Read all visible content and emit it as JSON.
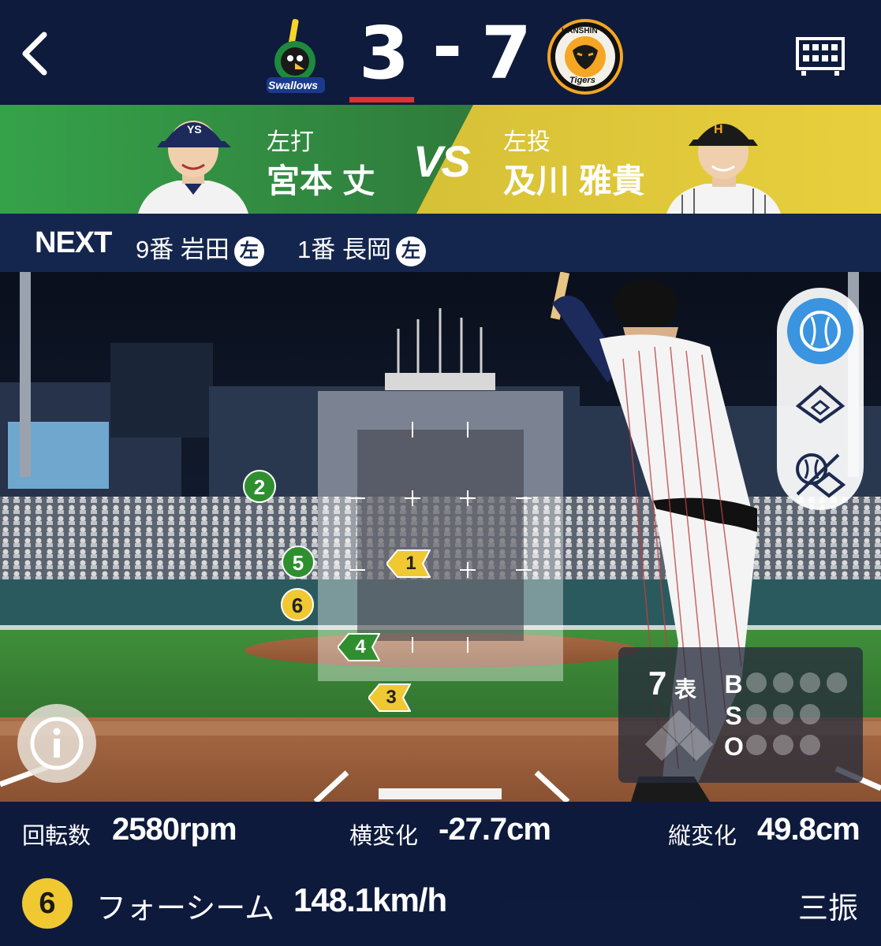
{
  "header": {
    "back_icon": "chevron-left-icon",
    "home_team_logo": "swallows-logo",
    "home_logo_text": "Swallows",
    "away_team_logo": "tigers-logo",
    "away_logo_top_text": "HANSHIN",
    "away_logo_bottom_text": "Tigers",
    "home_score": "3",
    "dash": "-",
    "away_score": "7",
    "scoreboard_icon": "scoreboard-icon"
  },
  "matchup": {
    "batter_hand_label": "左打",
    "batter_name": "宮本 丈",
    "vs_label": "VS",
    "pitcher_hand_label": "左投",
    "pitcher_name": "及川 雅貴",
    "batter_color": "#3aa84f",
    "pitcher_color": "#e3c93a"
  },
  "next": {
    "label": "NEXT",
    "items": [
      {
        "order": "9番 岩田",
        "hand": "左"
      },
      {
        "order": "1番 長岡",
        "hand": "左"
      }
    ]
  },
  "side_controls": [
    "pitch-icon",
    "field-diamond-icon",
    "pitch-field-icon"
  ],
  "pitches": [
    {
      "num": "1",
      "style": "yellow-arrow"
    },
    {
      "num": "2",
      "style": "green-circle"
    },
    {
      "num": "3",
      "style": "yellow-arrow"
    },
    {
      "num": "4",
      "style": "green-arrow"
    },
    {
      "num": "5",
      "style": "green-circle"
    },
    {
      "num": "6",
      "style": "yellow-circle"
    }
  ],
  "count": {
    "inning": "7",
    "half": "表",
    "b_label": "B",
    "s_label": "S",
    "o_label": "O"
  },
  "stats": {
    "spin_label": "回転数",
    "spin_value": "2580rpm",
    "horizontal_label": "横変化",
    "horizontal_value": "-27.7cm",
    "vertical_label": "縦変化",
    "vertical_value": "49.8cm"
  },
  "current_pitch": {
    "number": "6",
    "type": "フォーシーム",
    "speed": "148.1km/h",
    "result": "三振"
  }
}
